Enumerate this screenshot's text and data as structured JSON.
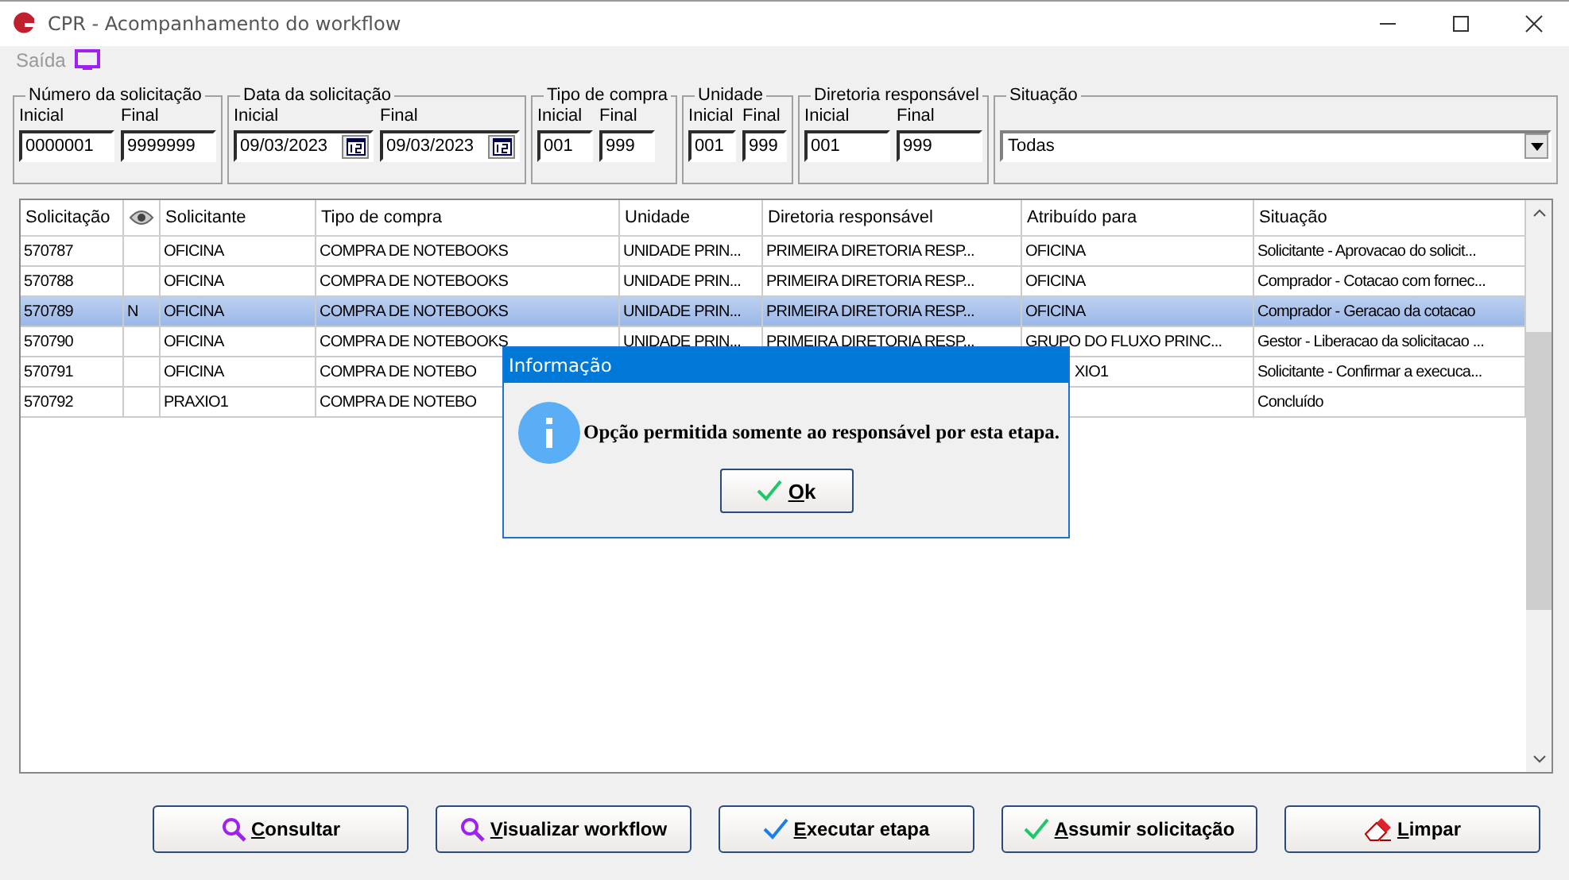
{
  "window": {
    "title": "CPR - Acompanhamento do workflow"
  },
  "menu": [
    {
      "label": "Saída"
    }
  ],
  "filters": [
    {
      "title": "Número da solicitação",
      "kind": "range",
      "fields": [
        {
          "label": "Inicial",
          "value": "0000001",
          "kind": "text"
        },
        {
          "label": "Final",
          "value": "9999999",
          "kind": "text"
        }
      ]
    },
    {
      "title": "Data da solicitação",
      "kind": "range",
      "fields": [
        {
          "label": "Inicial",
          "value": "09/03/2023",
          "kind": "date"
        },
        {
          "label": "Final",
          "value": "09/03/2023",
          "kind": "date"
        }
      ]
    },
    {
      "title": "Tipo de compra",
      "kind": "range",
      "fields": [
        {
          "label": "Inicial",
          "value": "001",
          "kind": "text"
        },
        {
          "label": "Final",
          "value": "999",
          "kind": "text"
        }
      ]
    },
    {
      "title": "Unidade",
      "kind": "range",
      "fields": [
        {
          "label": "Inicial",
          "value": "001",
          "kind": "text"
        },
        {
          "label": "Final",
          "value": "999",
          "kind": "text"
        }
      ]
    },
    {
      "title": "Diretoria responsável",
      "kind": "range",
      "fields": [
        {
          "label": "Inicial",
          "value": "001",
          "kind": "text"
        },
        {
          "label": "Final",
          "value": "999",
          "kind": "text"
        }
      ]
    },
    {
      "title": "Situação",
      "kind": "select",
      "value": "Todas"
    }
  ],
  "table": {
    "columns": [
      {
        "label": "Solicitação",
        "kind": "text"
      },
      {
        "kind": "eye"
      },
      {
        "label": "Solicitante",
        "kind": "text"
      },
      {
        "label": "Tipo de compra",
        "kind": "text"
      },
      {
        "label": "Unidade",
        "kind": "text"
      },
      {
        "label": "Diretoria responsável",
        "kind": "text"
      },
      {
        "label": "Atribuído para",
        "kind": "text"
      },
      {
        "label": "Situação",
        "kind": "text"
      }
    ],
    "rows": [
      {
        "selected": false,
        "cells": [
          "570787",
          null,
          "OFICINA",
          "COMPRA DE NOTEBOOKS",
          "UNIDADE PRIN...",
          "PRIMEIRA DIRETORIA RESP...",
          "OFICINA",
          "Solicitante - Aprovacao do solicit..."
        ]
      },
      {
        "selected": false,
        "cells": [
          "570788",
          null,
          "OFICINA",
          "COMPRA DE NOTEBOOKS",
          "UNIDADE PRIN...",
          "PRIMEIRA DIRETORIA RESP...",
          "OFICINA",
          "Comprador - Cotacao com fornec..."
        ]
      },
      {
        "selected": true,
        "cells": [
          "570789",
          "N",
          "OFICINA",
          "COMPRA DE NOTEBOOKS",
          "UNIDADE PRIN...",
          "PRIMEIRA DIRETORIA RESP...",
          "OFICINA",
          "Comprador - Geracao da cotacao"
        ]
      },
      {
        "selected": false,
        "cells": [
          "570790",
          null,
          "OFICINA",
          "COMPRA DE NOTEBOOKS",
          "UNIDADE PRIN...",
          "PRIMEIRA DIRETORIA RESP...",
          "GRUPO DO FLUXO PRINC...",
          "Gestor - Liberacao da solicitacao ..."
        ]
      },
      {
        "selected": false,
        "cells": [
          "570791",
          null,
          "OFICINA",
          "COMPRA DE NOTEBO",
          null,
          null,
          {
            "text": "XIO1",
            "covered_start": true
          },
          "Solicitante - Confirmar a execuca..."
        ]
      },
      {
        "selected": false,
        "cells": [
          "570792",
          null,
          "PRAXIO1",
          "COMPRA DE NOTEBO",
          null,
          null,
          null,
          "Concluído"
        ]
      }
    ]
  },
  "dialog": {
    "title": "Informação",
    "message": "Opção permitida somente ao responsável por esta etapa.",
    "button": "Ok"
  },
  "buttons": [
    {
      "label": "Consultar",
      "kind": "search"
    },
    {
      "label": "Visualizar workflow",
      "kind": "search"
    },
    {
      "label": "Executar etapa",
      "kind": "check"
    },
    {
      "label": "Assumir solicitação",
      "kind": "check-green"
    },
    {
      "label": "Limpar",
      "kind": "eraser"
    }
  ]
}
